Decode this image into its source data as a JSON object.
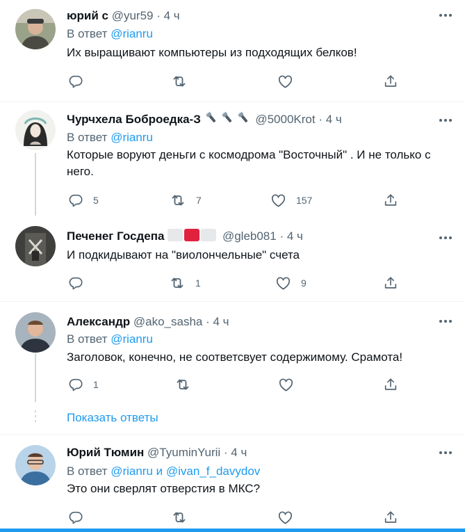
{
  "colors": {
    "accent": "#1d9bf0",
    "muted": "#536471",
    "text": "#0f1419",
    "separator": "#eff3f4",
    "flag_red": "#e0223f"
  },
  "tweets": [
    {
      "name": "юрий с",
      "handle": "@yur59",
      "time": "· 4 ч",
      "reply_prefix": "В ответ",
      "reply_to": "@rianru",
      "text": "Их выращивают компьютеры из подходящих белков!",
      "counts": {
        "reply": "",
        "retweet": "",
        "like": ""
      }
    },
    {
      "name": "Чурчхела Боброедка-З",
      "handle": "@5000Krot",
      "time": "· 4 ч",
      "name_emoji": [
        "flashlight-icon",
        "flashlight-icon",
        "flashlight-icon"
      ],
      "reply_prefix": "В ответ",
      "reply_to": "@rianru",
      "text": "Которые воруют деньги с космодрома \"Восточный\" . И не только с него.",
      "counts": {
        "reply": "5",
        "retweet": "7",
        "like": "157"
      }
    },
    {
      "name": "Печенег Госдепа",
      "handle": "@gleb081",
      "time": "· 4 ч",
      "name_emoji": [
        "flag-white-square",
        "flag-red-square",
        "flag-white-square"
      ],
      "text": "И подкидывают на \"виолончельные\" счета",
      "counts": {
        "reply": "",
        "retweet": "1",
        "like": "9"
      }
    },
    {
      "name": "Александр",
      "handle": "@ako_sasha",
      "time": "· 4 ч",
      "reply_prefix": "В ответ",
      "reply_to": "@rianru",
      "text": "Заголовок, конечно, не соответсвует содержимому. Срамота!",
      "counts": {
        "reply": "1",
        "retweet": "",
        "like": ""
      }
    },
    {
      "name": "Юрий Тюмин",
      "handle": "@TyuminYurii",
      "time": "· 4 ч",
      "reply_prefix": "В ответ",
      "reply_to": "@rianru",
      "reply_and": "и",
      "reply_to_2": "@ivan_f_davydov",
      "text": "Это они сверлят отверстия в МКС?",
      "counts": {
        "reply": "",
        "retweet": "",
        "like": ""
      }
    }
  ],
  "show_replies": "Показать ответы"
}
